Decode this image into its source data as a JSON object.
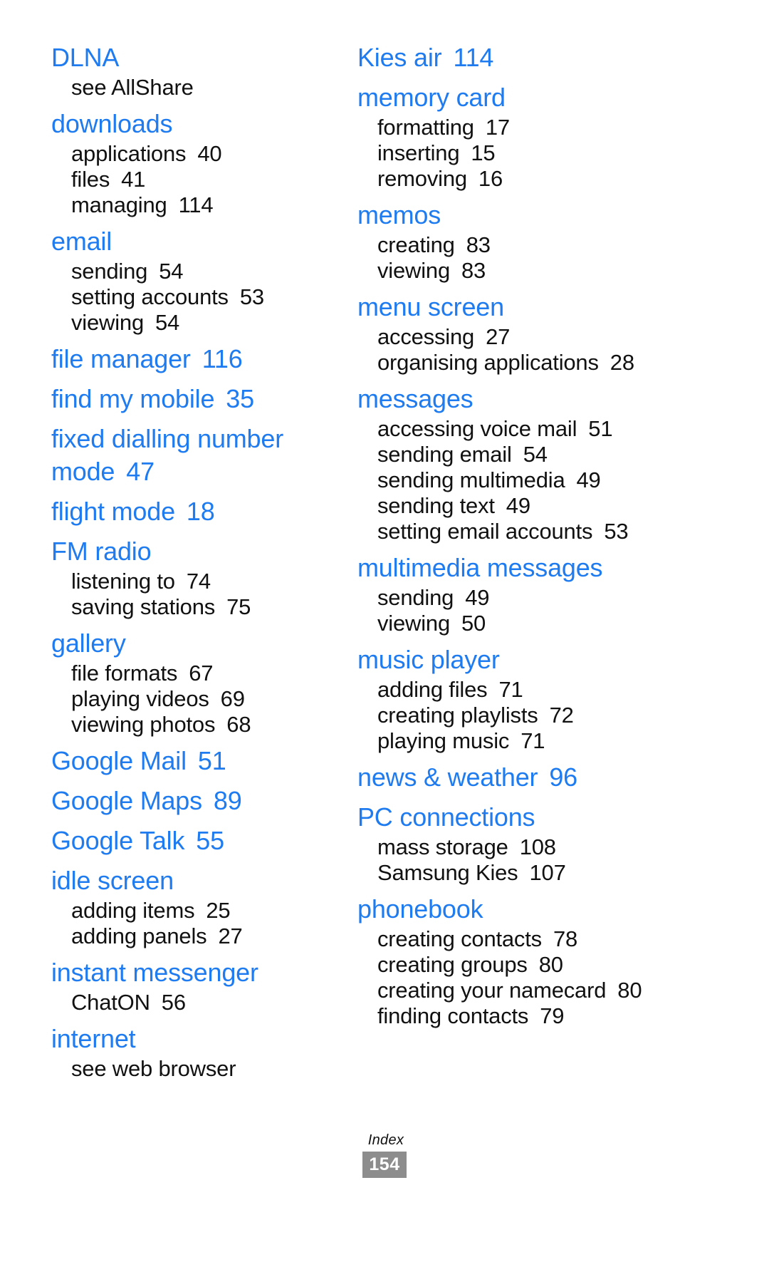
{
  "document": {
    "type": "index",
    "footer_label": "Index",
    "page_number": "154",
    "accent_color": "#1f7bf0",
    "text_color": "#111111",
    "badge_color": "#8d8d8d"
  },
  "columns": [
    {
      "id": "left",
      "entries": [
        {
          "term": "DLNA",
          "page": "",
          "subentries": [
            {
              "term": "see AllShare",
              "page": ""
            }
          ]
        },
        {
          "term": "downloads",
          "page": "",
          "subentries": [
            {
              "term": "applications",
              "page": "40"
            },
            {
              "term": "files",
              "page": "41"
            },
            {
              "term": "managing",
              "page": "114"
            }
          ]
        },
        {
          "term": "email",
          "page": "",
          "subentries": [
            {
              "term": "sending",
              "page": "54"
            },
            {
              "term": "setting accounts",
              "page": "53"
            },
            {
              "term": "viewing",
              "page": "54"
            }
          ]
        },
        {
          "term": "file manager",
          "page": "116",
          "subentries": []
        },
        {
          "term": "find my mobile",
          "page": "35",
          "subentries": []
        },
        {
          "term": "fixed dialling number mode",
          "page": "47",
          "subentries": []
        },
        {
          "term": "flight mode",
          "page": "18",
          "subentries": []
        },
        {
          "term": "FM radio",
          "page": "",
          "subentries": [
            {
              "term": "listening to",
              "page": "74"
            },
            {
              "term": "saving stations",
              "page": "75"
            }
          ]
        },
        {
          "term": "gallery",
          "page": "",
          "subentries": [
            {
              "term": "file formats",
              "page": "67"
            },
            {
              "term": "playing videos",
              "page": "69"
            },
            {
              "term": "viewing photos",
              "page": "68"
            }
          ]
        },
        {
          "term": "Google Mail",
          "page": "51",
          "subentries": []
        },
        {
          "term": "Google Maps",
          "page": "89",
          "subentries": []
        },
        {
          "term": "Google Talk",
          "page": "55",
          "subentries": []
        },
        {
          "term": "idle screen",
          "page": "",
          "subentries": [
            {
              "term": "adding items",
              "page": "25"
            },
            {
              "term": "adding panels",
              "page": "27"
            }
          ]
        },
        {
          "term": "instant messenger",
          "page": "",
          "subentries": [
            {
              "term": "ChatON",
              "page": "56"
            }
          ]
        },
        {
          "term": "internet",
          "page": "",
          "subentries": [
            {
              "term": "see web browser",
              "page": ""
            }
          ]
        }
      ]
    },
    {
      "id": "right",
      "entries": [
        {
          "term": "Kies air",
          "page": "114",
          "subentries": []
        },
        {
          "term": "memory card",
          "page": "",
          "subentries": [
            {
              "term": "formatting",
              "page": "17"
            },
            {
              "term": "inserting",
              "page": "15"
            },
            {
              "term": "removing",
              "page": "16"
            }
          ]
        },
        {
          "term": "memos",
          "page": "",
          "subentries": [
            {
              "term": "creating",
              "page": "83"
            },
            {
              "term": "viewing",
              "page": "83"
            }
          ]
        },
        {
          "term": "menu screen",
          "page": "",
          "subentries": [
            {
              "term": "accessing",
              "page": "27"
            },
            {
              "term": "organising applications",
              "page": "28"
            }
          ]
        },
        {
          "term": "messages",
          "page": "",
          "subentries": [
            {
              "term": "accessing voice mail",
              "page": "51"
            },
            {
              "term": "sending email",
              "page": "54"
            },
            {
              "term": "sending multimedia",
              "page": "49"
            },
            {
              "term": "sending text",
              "page": "49"
            },
            {
              "term": "setting email accounts",
              "page": "53"
            }
          ]
        },
        {
          "term": "multimedia messages",
          "page": "",
          "subentries": [
            {
              "term": "sending",
              "page": "49"
            },
            {
              "term": "viewing",
              "page": "50"
            }
          ]
        },
        {
          "term": "music player",
          "page": "",
          "subentries": [
            {
              "term": "adding files",
              "page": "71"
            },
            {
              "term": "creating playlists",
              "page": "72"
            },
            {
              "term": "playing music",
              "page": "71"
            }
          ]
        },
        {
          "term": "news & weather",
          "page": "96",
          "subentries": []
        },
        {
          "term": "PC connections",
          "page": "",
          "subentries": [
            {
              "term": "mass storage",
              "page": "108"
            },
            {
              "term": "Samsung Kies",
              "page": "107"
            }
          ]
        },
        {
          "term": "phonebook",
          "page": "",
          "subentries": [
            {
              "term": "creating contacts",
              "page": "78"
            },
            {
              "term": "creating groups",
              "page": "80"
            },
            {
              "term": "creating your namecard",
              "page": "80"
            },
            {
              "term": "finding contacts",
              "page": "79"
            }
          ]
        }
      ]
    }
  ]
}
